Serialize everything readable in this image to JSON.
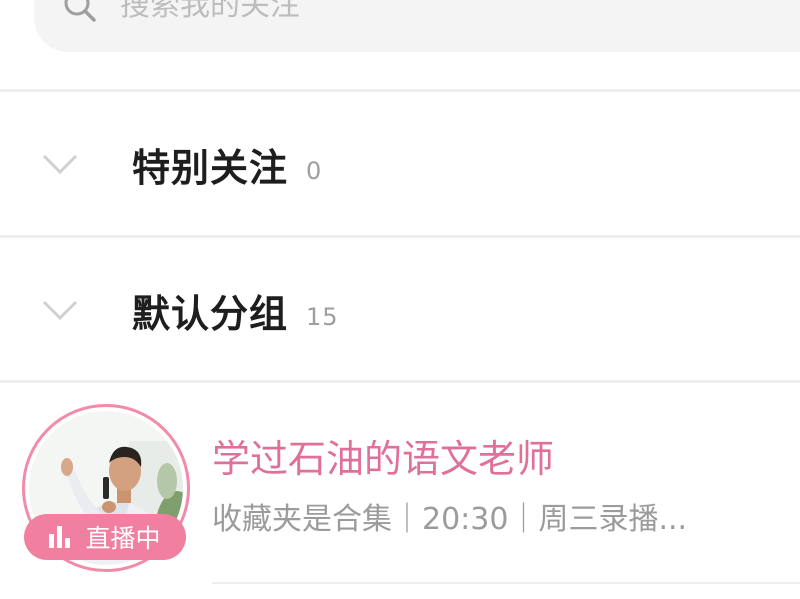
{
  "search": {
    "placeholder": "搜索我的关注"
  },
  "groups": [
    {
      "name": "特别关注",
      "count": "0"
    },
    {
      "name": "默认分组",
      "count": "15"
    }
  ],
  "following": [
    {
      "name": "学过石油的语文老师",
      "description": "收藏夹是合集｜20:30｜周三录播...",
      "live_badge": "直播中"
    }
  ],
  "colors": {
    "accent_pink": "#f07fa0",
    "name_pink": "#e0709a",
    "gray_text": "#9b9b9b"
  }
}
